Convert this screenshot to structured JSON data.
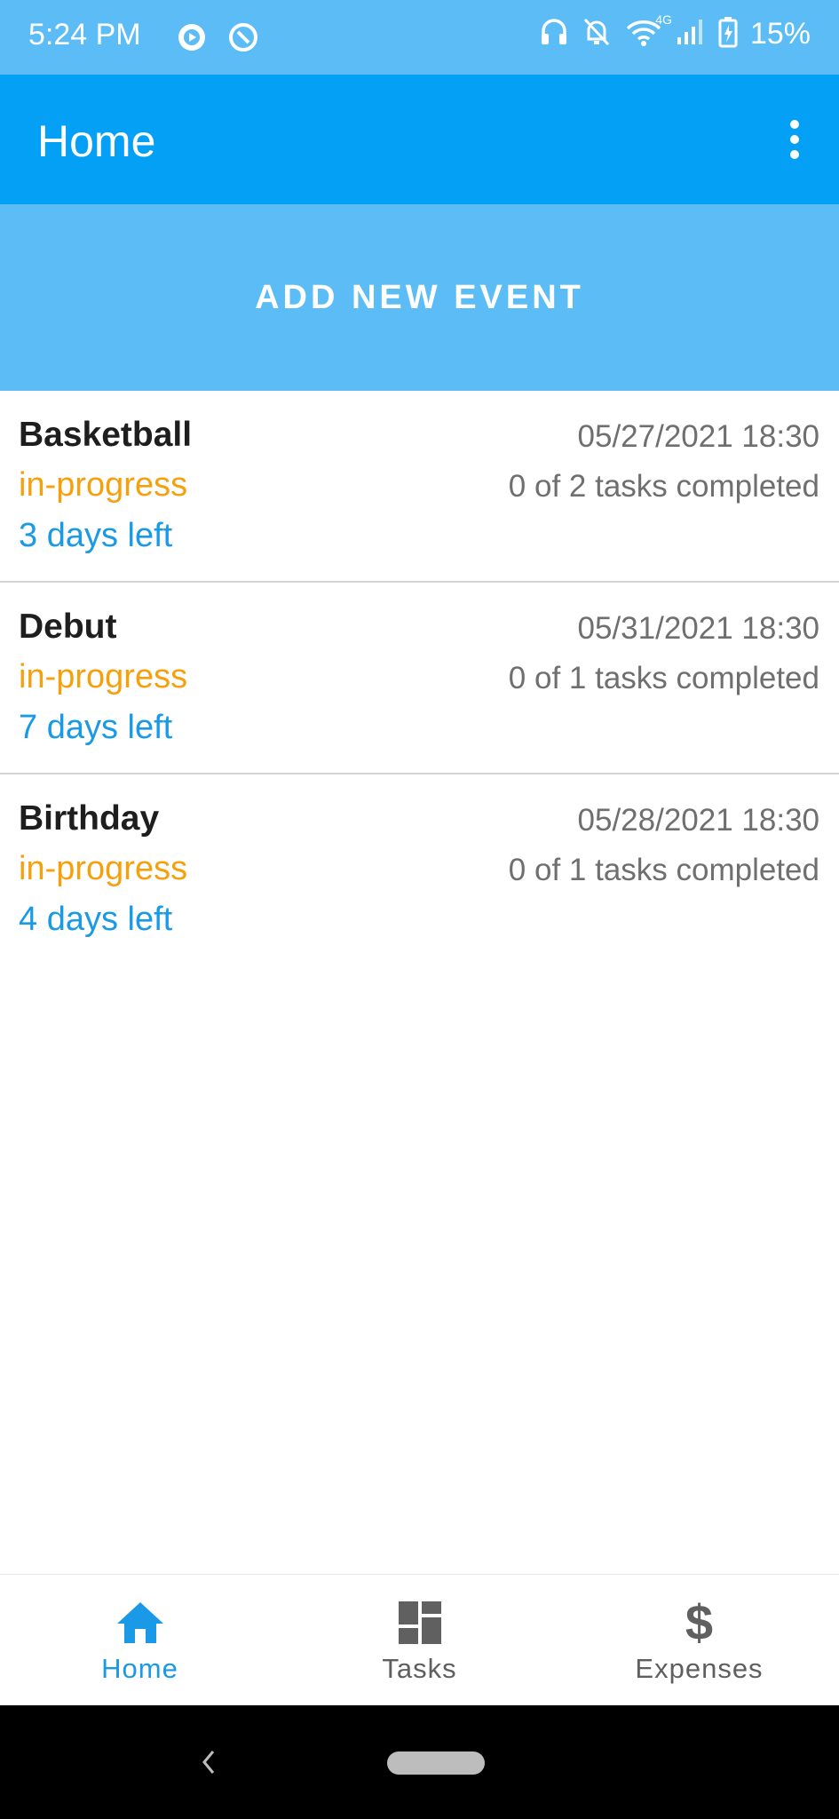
{
  "status_bar": {
    "time": "5:24 PM",
    "network_label": "4G",
    "battery": "15%"
  },
  "app_bar": {
    "title": "Home"
  },
  "add_event_button": {
    "label": "ADD NEW EVENT"
  },
  "events": [
    {
      "name": "Basketball",
      "status": "in-progress",
      "days_left": "3 days left",
      "datetime": "05/27/2021 18:30",
      "tasks": "0 of 2 tasks completed"
    },
    {
      "name": "Debut",
      "status": "in-progress",
      "days_left": "7 days left",
      "datetime": "05/31/2021 18:30",
      "tasks": "0 of 1 tasks completed"
    },
    {
      "name": "Birthday",
      "status": "in-progress",
      "days_left": "4 days left",
      "datetime": "05/28/2021 18:30",
      "tasks": "0 of 1 tasks completed"
    }
  ],
  "bottom_nav": {
    "items": [
      {
        "label": "Home",
        "icon": "home-icon",
        "active": true
      },
      {
        "label": "Tasks",
        "icon": "dashboard-icon",
        "active": false
      },
      {
        "label": "Expenses",
        "icon": "dollar-icon",
        "active": false
      }
    ]
  },
  "colors": {
    "status_bar": "#5bbcf6",
    "app_bar": "#03a0f5",
    "status_in_progress": "#f5a00d",
    "days_left": "#1a9ae6",
    "nav_active": "#1a9ae6"
  }
}
